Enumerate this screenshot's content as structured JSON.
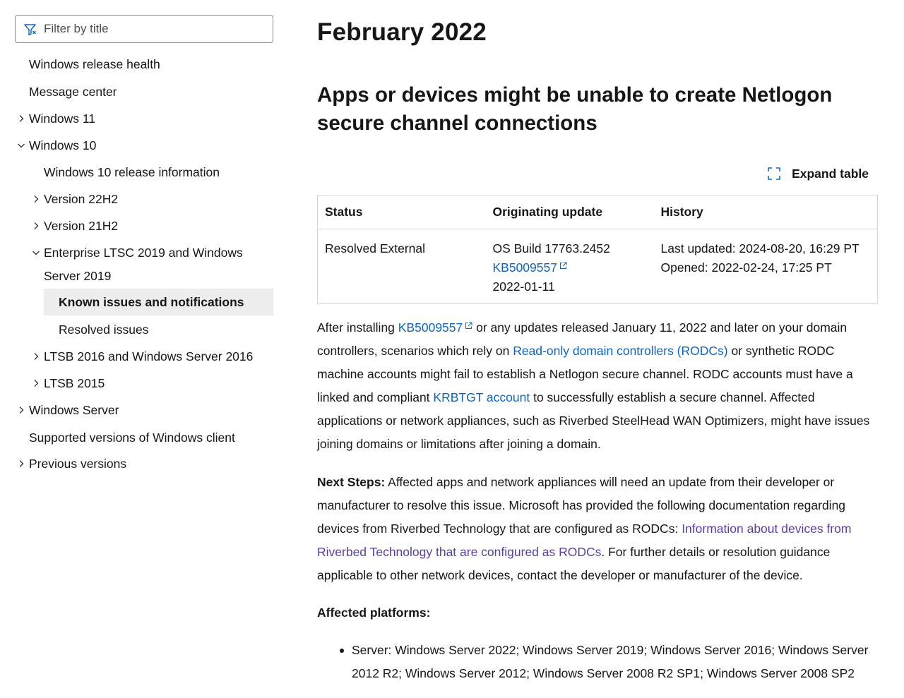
{
  "sidebar": {
    "filter_placeholder": "Filter by title",
    "items": [
      {
        "label": "Windows release health"
      },
      {
        "label": "Message center"
      },
      {
        "label": "Windows 11"
      },
      {
        "label": "Windows 10"
      },
      {
        "label": "Windows 10 release information"
      },
      {
        "label": "Version 22H2"
      },
      {
        "label": "Version 21H2"
      },
      {
        "label": "Enterprise LTSC 2019 and Windows Server 2019"
      },
      {
        "label": "Known issues and notifications"
      },
      {
        "label": "Resolved issues"
      },
      {
        "label": "LTSB 2016 and Windows Server 2016"
      },
      {
        "label": "LTSB 2015"
      },
      {
        "label": "Windows Server"
      },
      {
        "label": "Supported versions of Windows client"
      },
      {
        "label": "Previous versions"
      }
    ]
  },
  "main": {
    "page_title": "February 2022",
    "issue_title": "Apps or devices might be unable to create Netlogon secure channel connections",
    "expand_label": "Expand table",
    "table": {
      "headers": [
        "Status",
        "Originating update",
        "History"
      ],
      "status": "Resolved External",
      "os_build": "OS Build 17763.2452",
      "kb_link": "KB5009557",
      "kb_date": "2022-01-11",
      "last_updated": "Last updated: 2024-08-20, 16:29 PT",
      "opened": "Opened: 2022-02-24, 17:25 PT"
    },
    "para1": {
      "t1": "After installing ",
      "link1": "KB5009557",
      "t2": " or any updates released January 11, 2022 and later on your domain controllers, scenarios which rely on ",
      "link2": "Read-only domain controllers (RODCs)",
      "t3": " or synthetic RODC machine accounts might fail to establish a Netlogon secure channel. RODC accounts must have a linked and compliant ",
      "link3": "KRBTGT account",
      "t4": " to successfully establish a secure channel. Affected applications or network appliances, such as Riverbed SteelHead WAN Optimizers, might have issues joining domains or limitations after joining a domain."
    },
    "para2": {
      "bold": "Next Steps:",
      "t1": " Affected apps and network appliances will need an update from their developer or manufacturer to resolve this issue. Microsoft has provided the following documentation regarding devices from Riverbed Technology that are configured as RODCs: ",
      "link1": "Information about devices from Riverbed Technology that are configured as RODCs",
      "t2": ". For further details or resolution guidance applicable to other network devices, contact the developer or manufacturer of the device."
    },
    "affected_heading": "Affected platforms:",
    "affected_items": [
      "Server: Windows Server 2022; Windows Server 2019; Windows Server 2016; Windows Server 2012 R2; Windows Server 2012; Windows Server 2008 R2 SP1; Windows Server 2008 SP2"
    ]
  },
  "colors": {
    "link": "#0f65b8",
    "visited_link": "#5a3ea0",
    "active_bg": "#ededed",
    "text": "#161616"
  },
  "icons": {
    "filter": "filter-icon",
    "chevron_right": "chevron-right-icon",
    "chevron_down": "chevron-down-icon",
    "expand": "expand-icon",
    "external": "external-link-icon"
  }
}
